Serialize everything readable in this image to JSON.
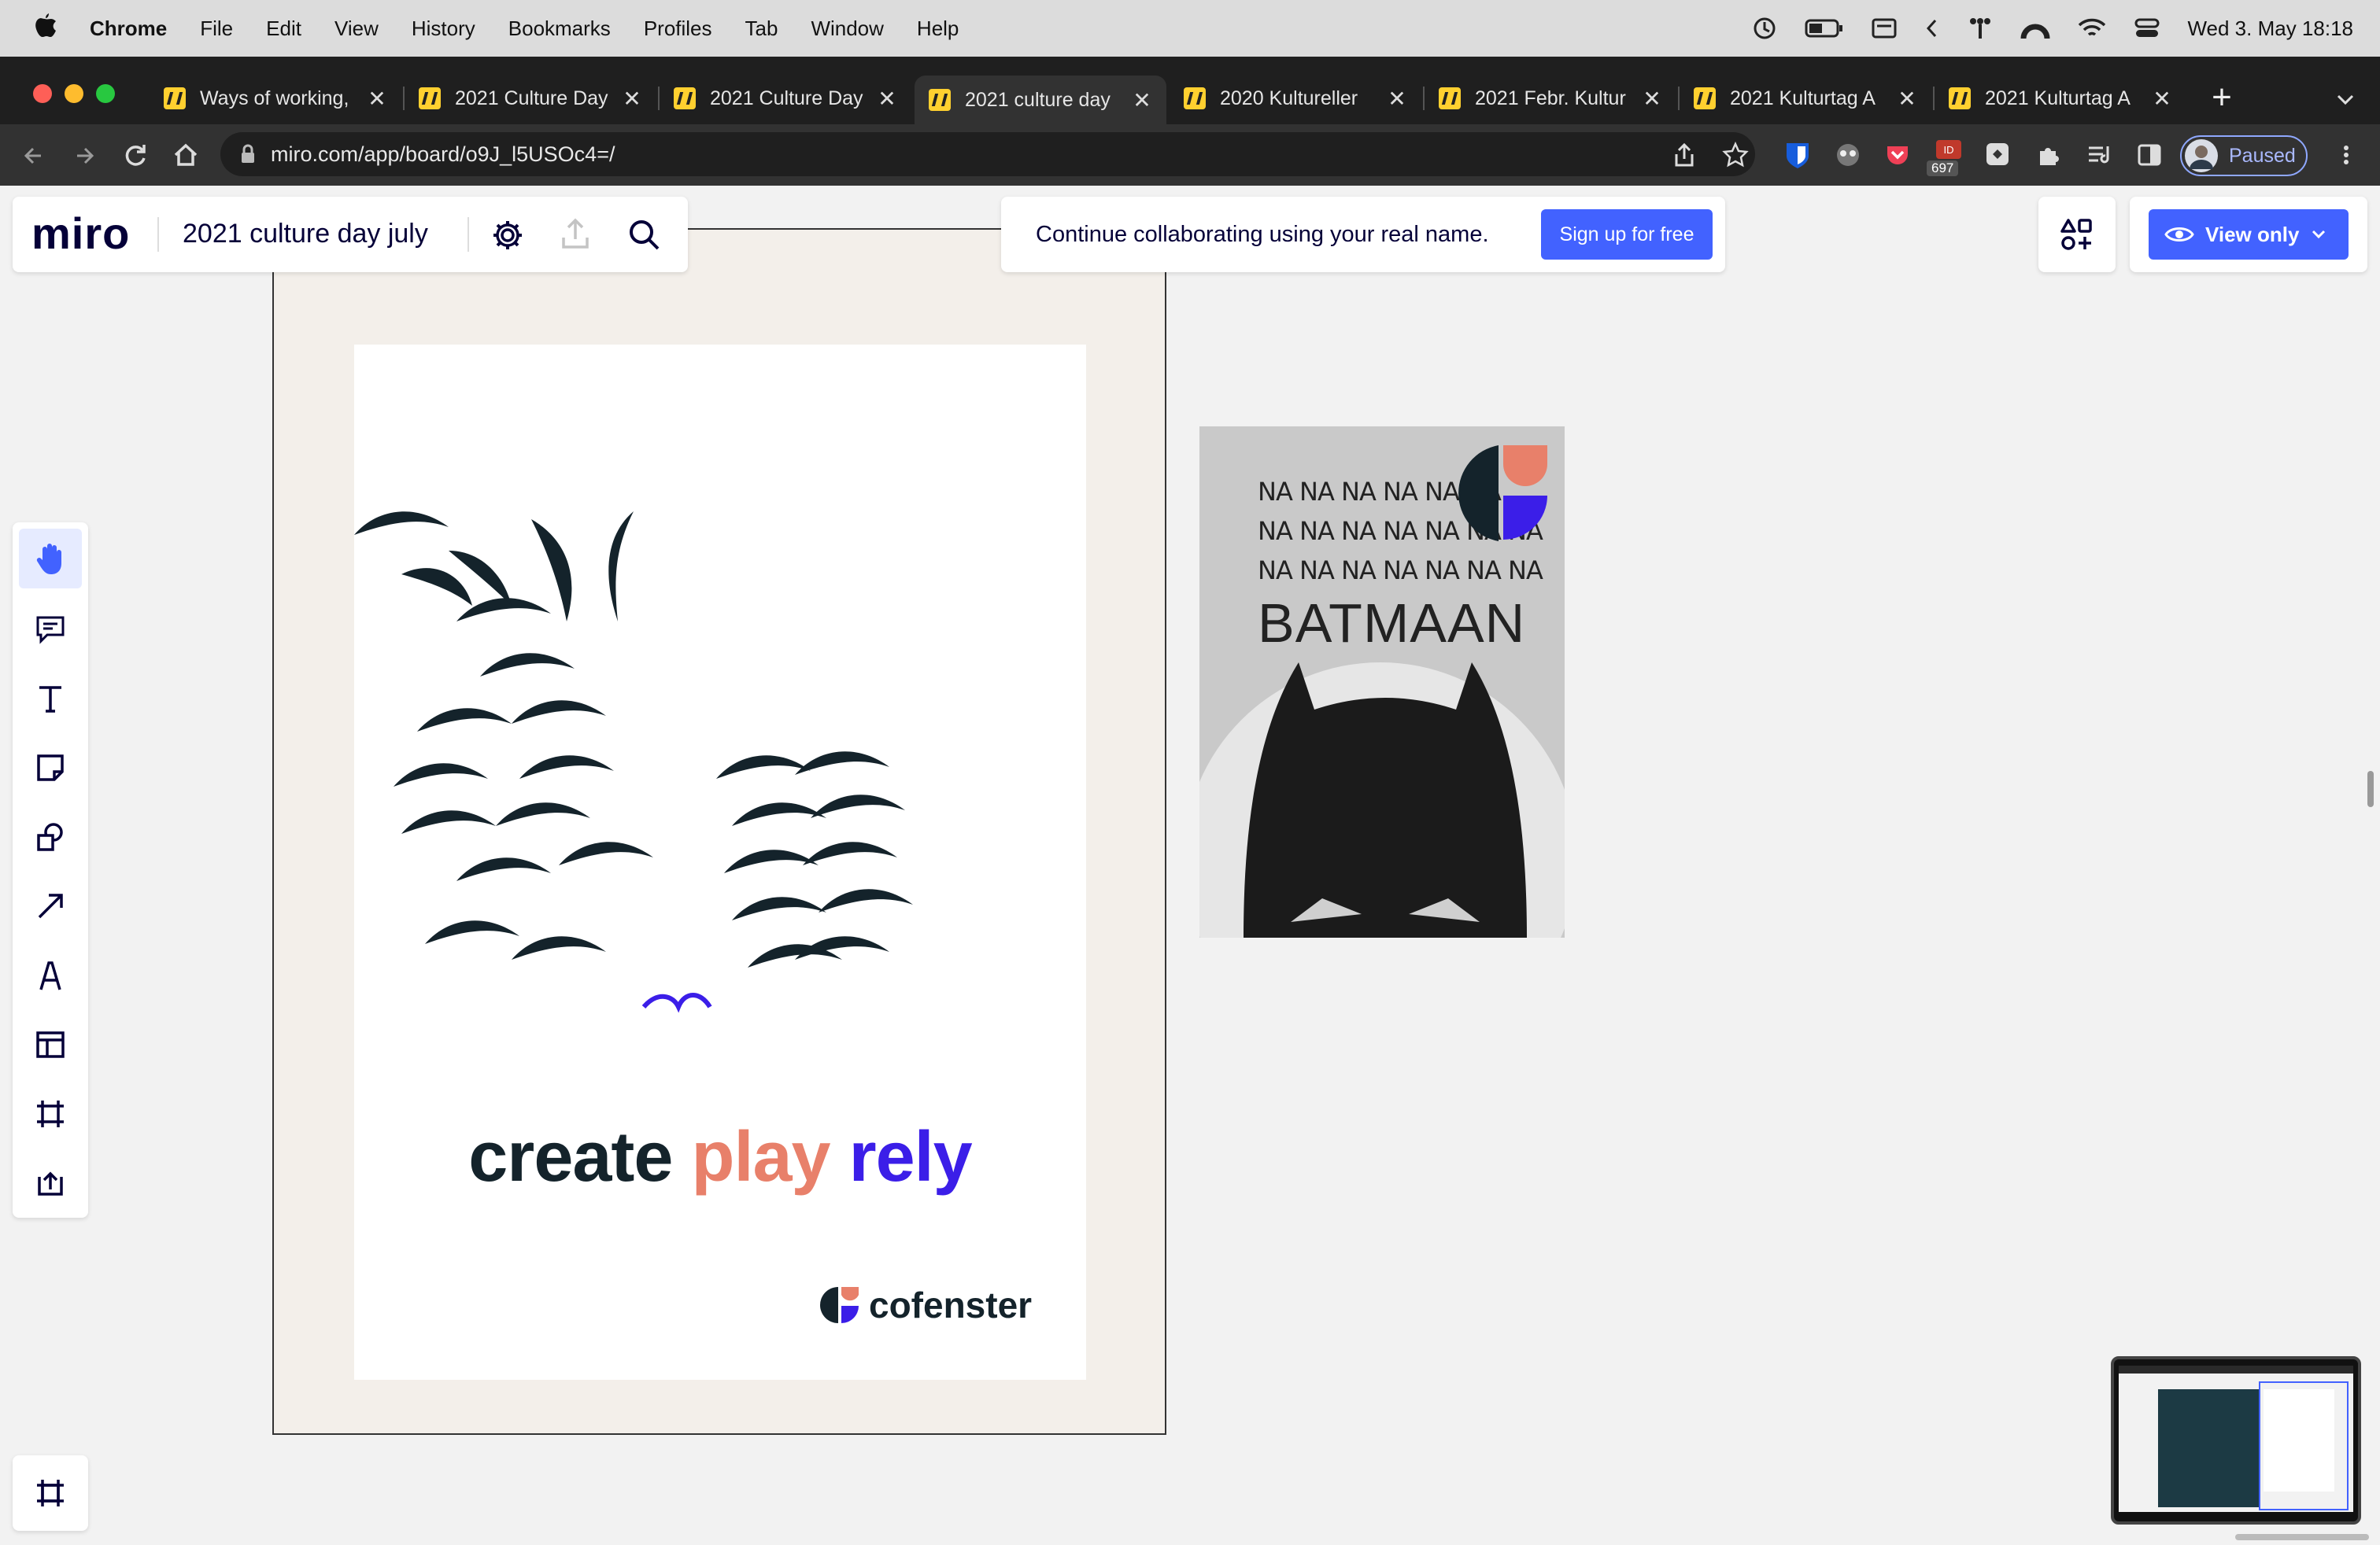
{
  "menubar": {
    "apple": "",
    "app": "Chrome",
    "items": [
      "File",
      "Edit",
      "View",
      "History",
      "Bookmarks",
      "Profiles",
      "Tab",
      "Window",
      "Help"
    ],
    "clock": "Wed 3. May  18:18"
  },
  "tabs": [
    {
      "title": "Ways of working,"
    },
    {
      "title": "2021 Culture Day"
    },
    {
      "title": "2021 Culture Day"
    },
    {
      "title": "2021 culture day"
    },
    {
      "title": "2020 Kultureller "
    },
    {
      "title": "2021 Febr. Kultur"
    },
    {
      "title": "2021 Kulturtag A"
    },
    {
      "title": "2021 Kulturtag A"
    }
  ],
  "new_tab": "+",
  "address": {
    "url": "miro.com/app/board/o9J_l5USOc4=/",
    "badge_count": "697",
    "profile_status": "Paused"
  },
  "miro": {
    "logo": "miro",
    "board_title": "2021 culture day july",
    "banner_text": "Continue collaborating using your real name.",
    "signup_label": "Sign up for free",
    "view_only_label": "View only"
  },
  "poster": {
    "tagline_create": "create",
    "tagline_play": "play",
    "tagline_rely": "rely",
    "brand": "cofenster",
    "colors": {
      "dark": "#14232b",
      "coral": "#e8806a",
      "violet": "#3b1ee8"
    }
  },
  "batman_image": {
    "lines": [
      "NA NA NA NA NA NA",
      "NA NA NA NA NA NA NA",
      "NA NA NA NA NA NA NA"
    ],
    "title": "BATMAAN"
  },
  "colors": {
    "miro_blue": "#4262ff",
    "tab_icon": "#ffd02f"
  }
}
